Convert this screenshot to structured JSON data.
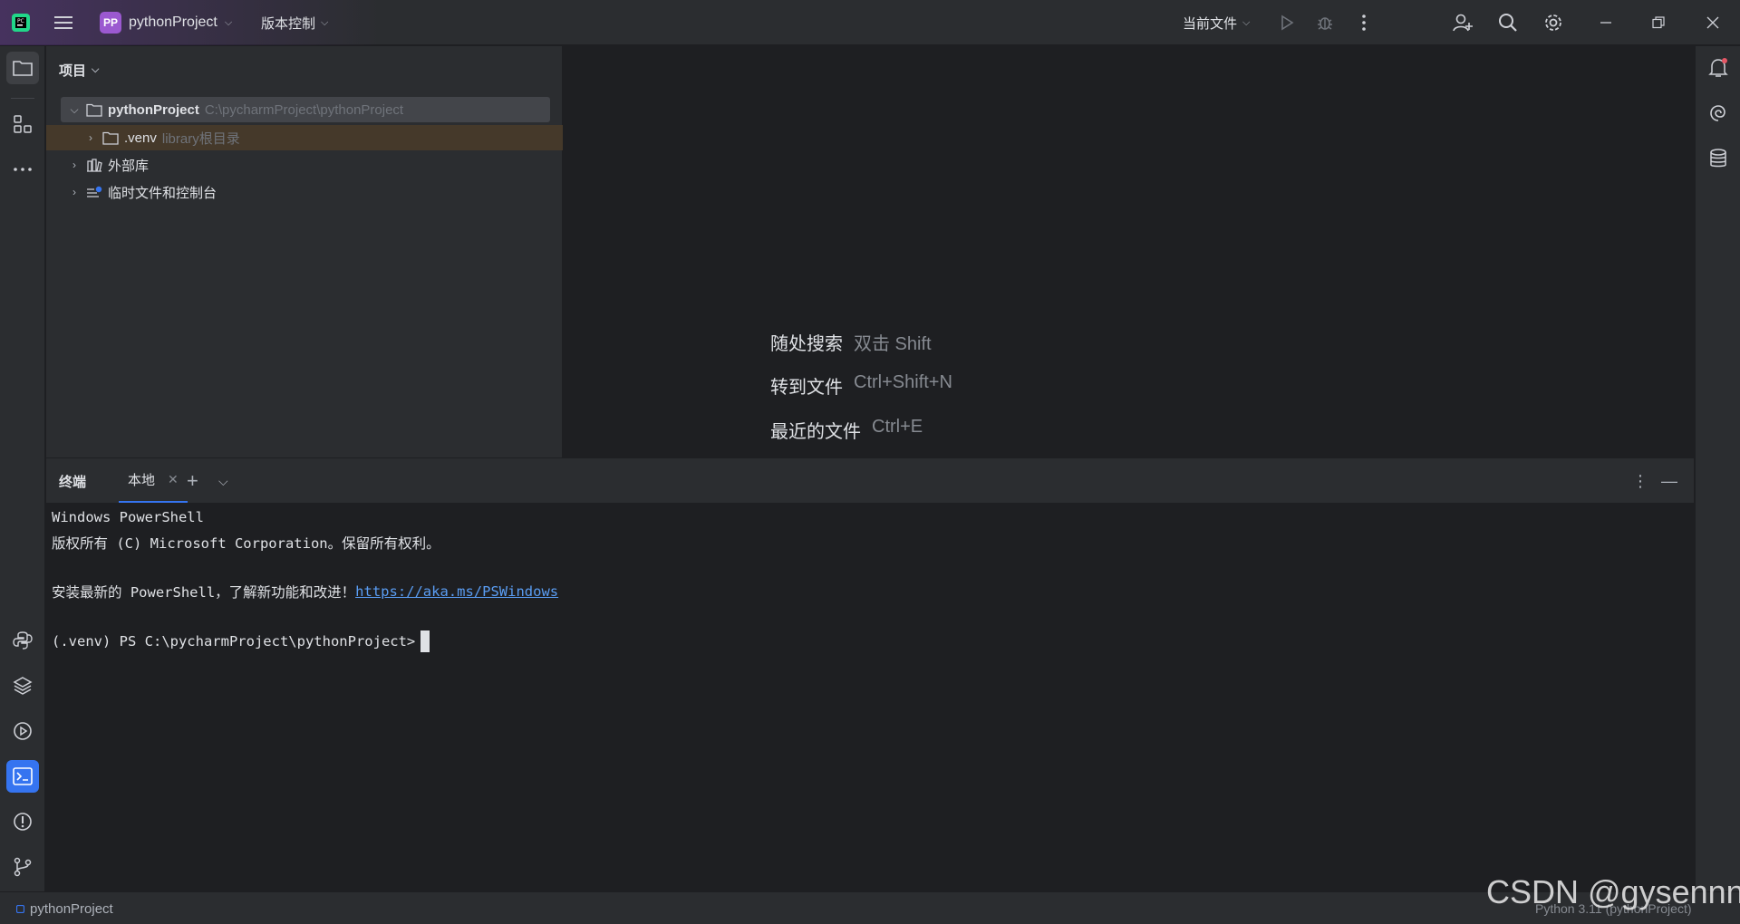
{
  "titlebar": {
    "project_badge": "PP",
    "project_name": "pythonProject",
    "vcs_label": "版本控制",
    "run_config": "当前文件"
  },
  "project_panel": {
    "header": "项目",
    "root": {
      "name": "pythonProject",
      "path": "C:\\pycharmProject\\pythonProject"
    },
    "venv": {
      "name": ".venv",
      "hint": "library根目录"
    },
    "external": "外部库",
    "scratches": "临时文件和控制台"
  },
  "welcome": {
    "items": [
      {
        "label": "随处搜索",
        "shortcut": "双击 Shift"
      },
      {
        "label": "转到文件",
        "shortcut": "Ctrl+Shift+N"
      },
      {
        "label": "最近的文件",
        "shortcut": "Ctrl+E"
      }
    ]
  },
  "terminal": {
    "title": "终端",
    "tab_label": "本地",
    "lines": {
      "l1": "Windows PowerShell",
      "l2": "版权所有 (C) Microsoft Corporation。保留所有权利。",
      "l3_prefix": "安装最新的 PowerShell，了解新功能和改进！",
      "l3_link": "https://aka.ms/PSWindows",
      "prompt": "(.venv) PS C:\\pycharmProject\\pythonProject>"
    }
  },
  "statusbar": {
    "project": "pythonProject",
    "interpreter": "Python 3.11 (pythonProject)"
  },
  "watermark": "CSDN @gysennn",
  "colors": {
    "accent": "#3574f0",
    "badge": "#9b59d0",
    "notification_dot": "#e55765"
  }
}
